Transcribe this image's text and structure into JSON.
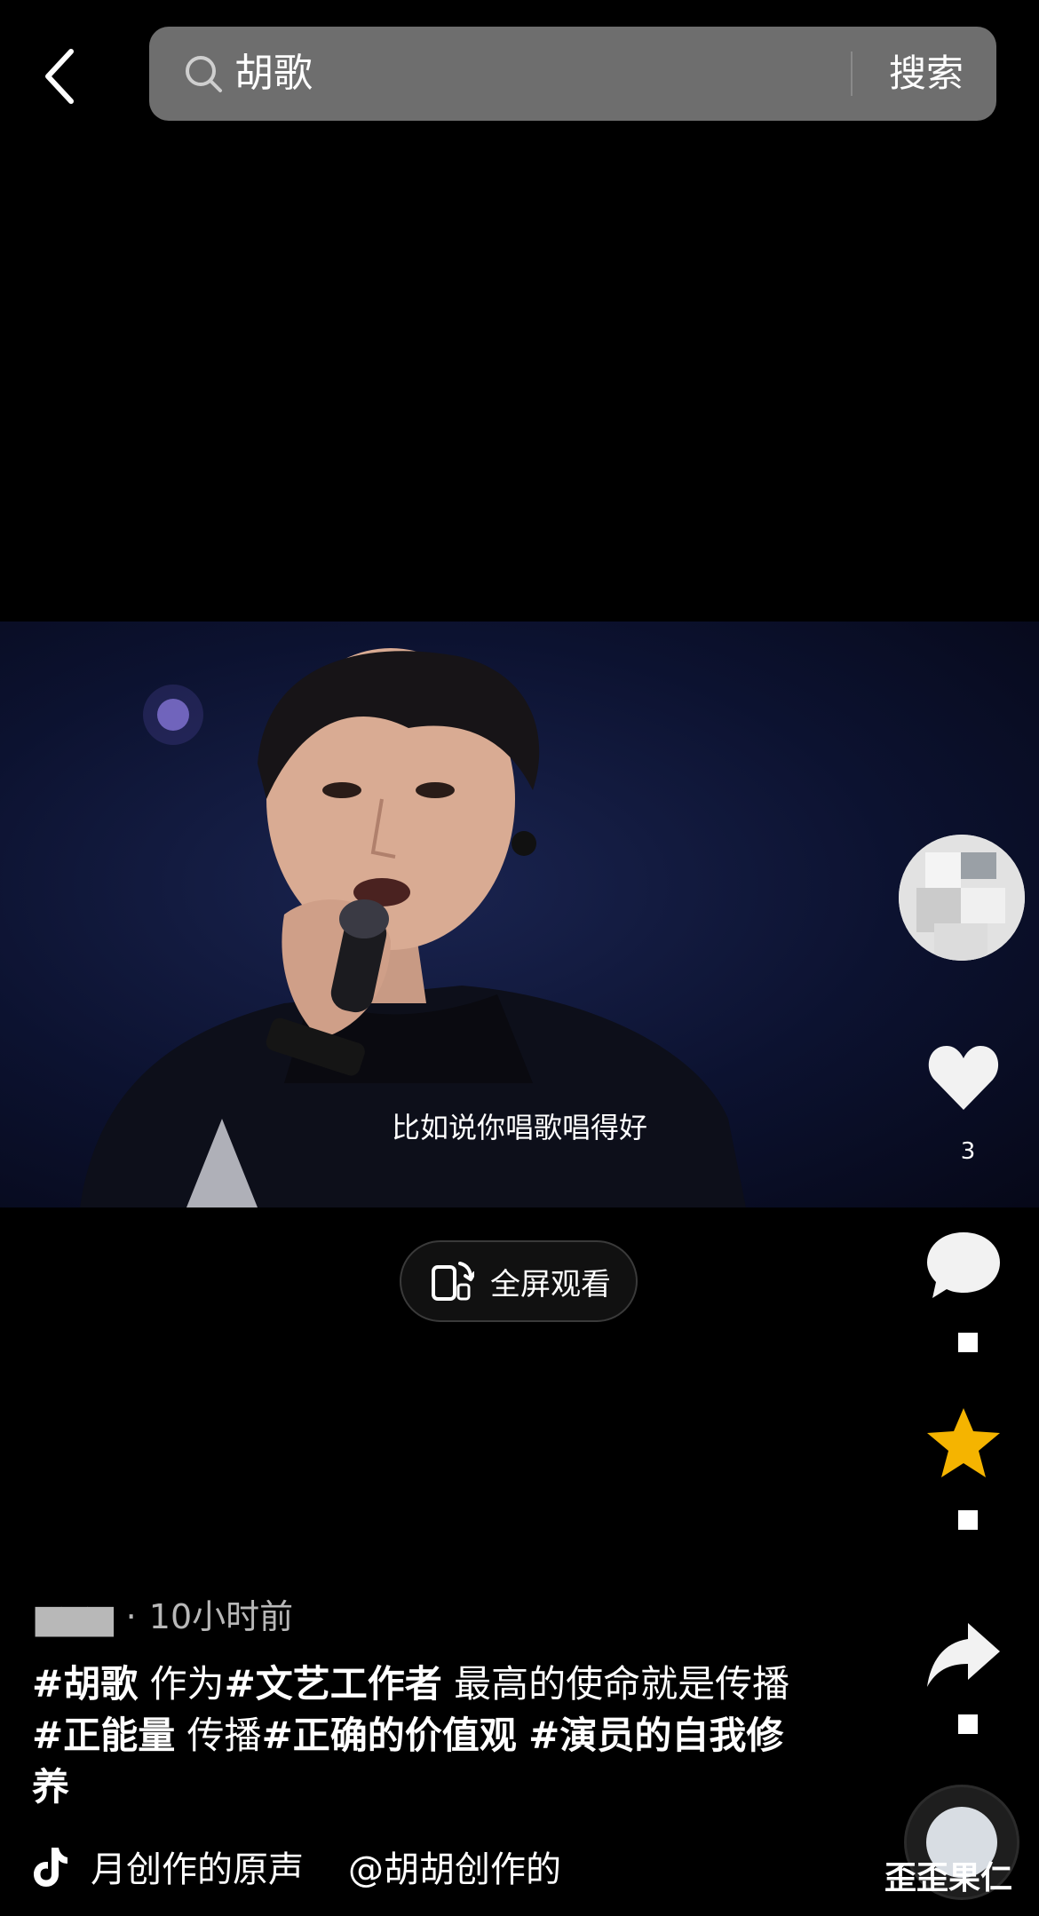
{
  "header": {
    "search_value": "胡歌",
    "search_button_label": "搜索"
  },
  "video": {
    "subtitle": "比如说你唱歌唱得好",
    "fullscreen_label": "全屏观看"
  },
  "rail": {
    "like_count": "3",
    "accent_color": "#f5b400"
  },
  "post": {
    "author_time": "10小时前",
    "caption_segments": [
      {
        "text": "#胡歌",
        "tag": true
      },
      {
        "text": " 作为",
        "tag": false
      },
      {
        "text": "#文艺工作者",
        "tag": true
      },
      {
        "text": " 最高的使命就是传播",
        "tag": false
      },
      {
        "text": "#正能量",
        "tag": true
      },
      {
        "text": " 传播",
        "tag": false
      },
      {
        "text": "#正确的价值观",
        "tag": true
      },
      {
        "text": " ",
        "tag": false
      },
      {
        "text": "#演员的自我修养",
        "tag": true
      }
    ],
    "music_text": "月创作的原声",
    "music_credit": "@胡胡创作的"
  },
  "watermark": "歪歪果仁"
}
